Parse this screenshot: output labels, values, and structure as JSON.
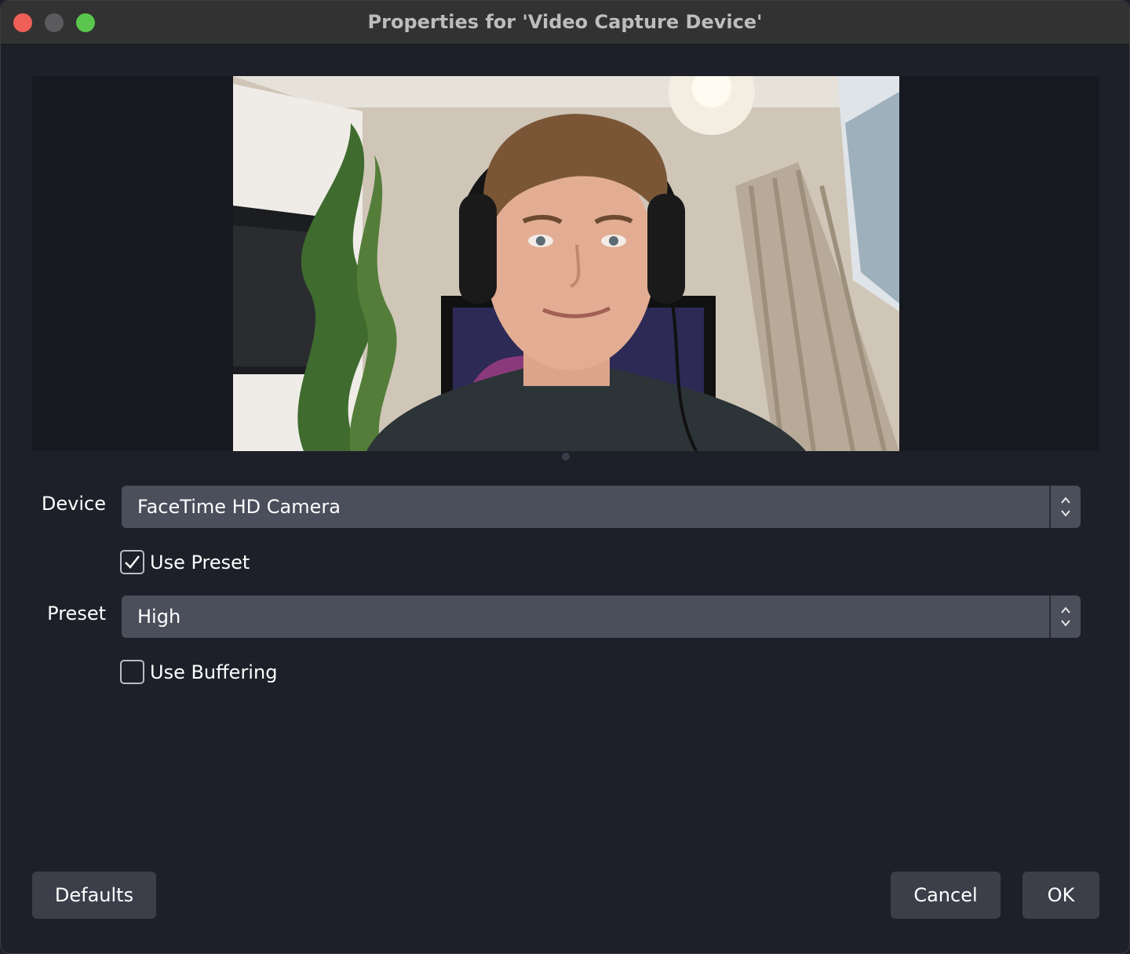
{
  "window": {
    "title": "Properties for 'Video Capture Device'"
  },
  "preview": {
    "description_icon": "webcam-feed"
  },
  "form": {
    "device_label": "Device",
    "device_value": "FaceTime HD Camera",
    "use_preset_label": "Use Preset",
    "use_preset_checked": true,
    "preset_label": "Preset",
    "preset_value": "High",
    "use_buffering_label": "Use Buffering",
    "use_buffering_checked": false
  },
  "buttons": {
    "defaults": "Defaults",
    "cancel": "Cancel",
    "ok": "OK"
  },
  "colors": {
    "background": "#1e2029",
    "select_bg": "#4b4e5b",
    "button_bg": "#3c3f4a",
    "close": "#ee5f57",
    "minimize": "#5b5b5e",
    "maximize": "#5ac64e"
  }
}
